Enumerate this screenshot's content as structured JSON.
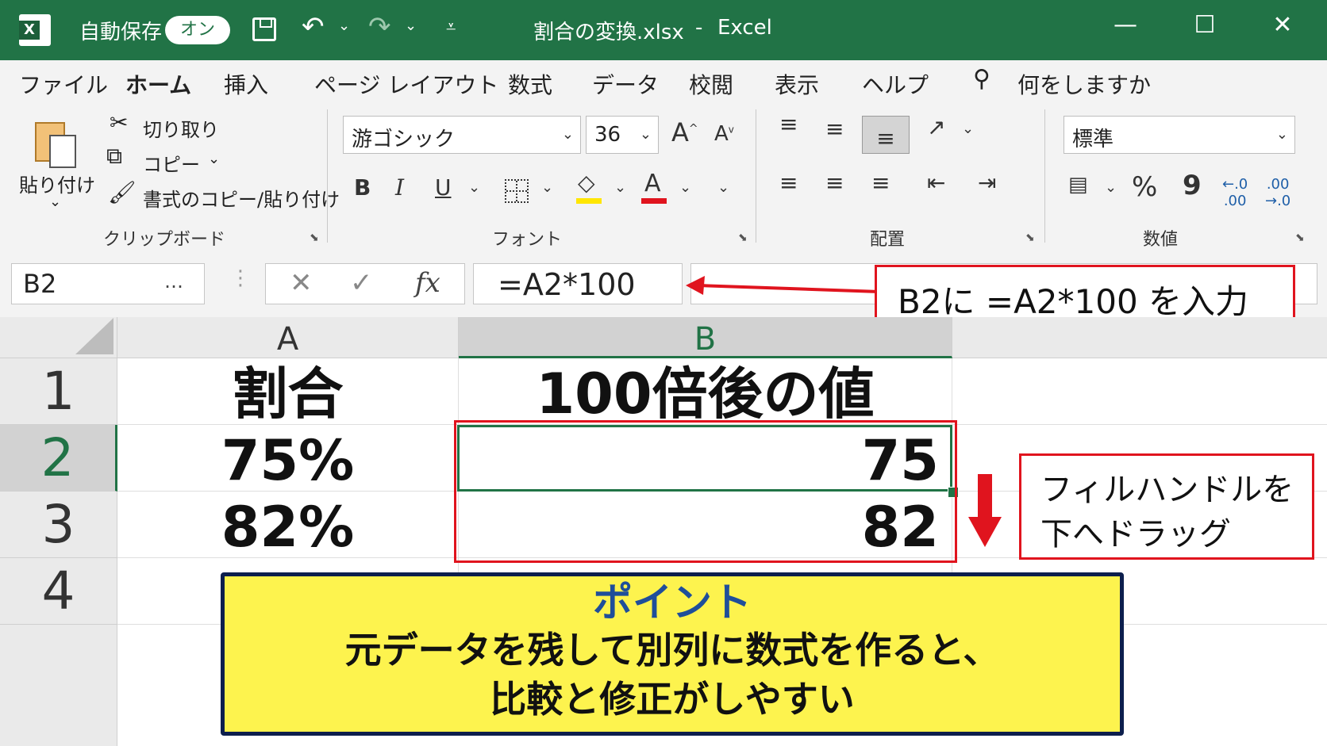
{
  "titlebar": {
    "autosave_label": "自動保存",
    "autosave_state": "オン",
    "file_title": "割合の変換.xlsx",
    "separator": "-",
    "app_name": "Excel"
  },
  "tabs": [
    "ファイル",
    "ホーム",
    "挿入",
    "ページ レイアウト",
    "数式",
    "データ",
    "校閲",
    "表示",
    "ヘルプ"
  ],
  "active_tab": "ホーム",
  "tell_me": "何をしますか",
  "ribbon": {
    "clipboard": {
      "paste": "貼り付け",
      "cut": "切り取り",
      "copy": "コピー",
      "format_painter": "書式のコピー/貼り付け",
      "group_label": "クリップボード"
    },
    "font": {
      "font_name": "游ゴシック",
      "font_size": "36",
      "bold": "B",
      "italic": "I",
      "underline": "U",
      "group_label": "フォント",
      "fill_color": "#ffe600",
      "font_color": "#e0141e"
    },
    "alignment": {
      "group_label": "配置"
    },
    "number": {
      "format": "標準",
      "percent": "%",
      "comma": "9",
      "group_label": "数値"
    }
  },
  "formula_bar": {
    "name_box": "B2",
    "name_dots": "…",
    "cancel": "✕",
    "enter": "✓",
    "fx": "fx",
    "formula": "=A2*100"
  },
  "grid": {
    "columns": [
      "A",
      "B"
    ],
    "rows": [
      {
        "num": "1",
        "a": "割合",
        "b": "100倍後の値"
      },
      {
        "num": "2",
        "a": "75%",
        "b": "75"
      },
      {
        "num": "3",
        "a": "82%",
        "b": "82"
      },
      {
        "num": "4",
        "a": "",
        "b": ""
      }
    ],
    "active_cell": "B2"
  },
  "annotations": {
    "formula_note": "B2に =A2*100 を入力",
    "fill_note_line1": "フィルハンドルを",
    "fill_note_line2": "下へドラッグ",
    "point_title": "ポイント",
    "point_line1": "元データを残して別列に数式を作ると、",
    "point_line2": "比較と修正がしやすい"
  },
  "colors": {
    "excel_green": "#217346",
    "callout_red": "#e0141e",
    "point_bg": "#fdf34e",
    "point_border": "#0d1f4d",
    "point_title": "#1f4e9a"
  }
}
